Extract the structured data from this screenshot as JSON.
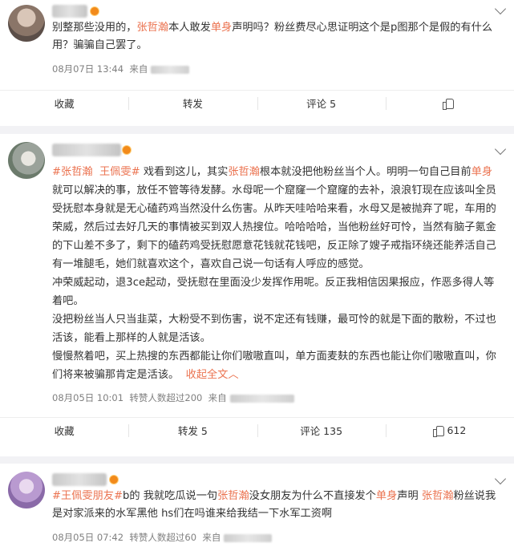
{
  "posts": [
    {
      "content": {
        "s1": "别整那些没用的，",
        "name1": "张哲瀚",
        "s2": "本人敢发",
        "kw1": "单身",
        "s3": "声明吗？粉丝费尽心思证明这个是p图那个是假的有什么用？骗骗自己罢了。"
      },
      "time": "08月07日 13:44",
      "source_prefix": "来自",
      "actions": {
        "fav": "收藏",
        "repost": "转发",
        "comment": "评论 5",
        "like": ""
      }
    },
    {
      "content": {
        "tag1": "#张哲瀚",
        "tag2": "王佩雯#",
        "a1": " 戏看到这儿，其实",
        "name1": "张哲瀚",
        "a2": "根本就没把他粉丝当个人。明明一句自己目前",
        "kw1": "单身",
        "a3": "就可以解决的事，放任不管等待发酵。水母呢一个窟窿一个窟窿的去补，浪浪钉现在应该叫全员受抚慰本身就是无心磕药鸡当然没什么伤害。从昨天哇哈哈来看，水母又是被抛弃了呢，车用的荣威，然后过去好几天的事情被买到双人热搜位。哈哈哈哈，当他粉丝好可怜，当然有脑子氪金的下山差不多了，剩下的磕药鸡受抚慰愿意花钱就花钱吧，反正除了嫂子戒指环绕还能养活自己有一堆腿毛，她们就喜欢这个，喜欢自己说一句话有人呼应的感觉。",
        "p2": "冲荣威起动，退3ce起动，受抚慰在里面没少发挥作用呢。反正我相信因果报应，作恶多得人等着吧。",
        "p3": "没把粉丝当人只当韭菜，大粉受不到伤害，说不定还有钱赚，最可怜的就是下面的散粉，不过也活该，能看上那样的人就是活该。",
        "p4": "慢慢熬着吧，买上热搜的东西都能让你们嗷嗷直叫，单方面麦麸的东西也能让你们嗷嗷直叫，你们将来被骗那肯定是活该。",
        "collapse": "收起全文",
        "collapse_icon": "chevron-up-icon"
      },
      "time": "08月05日 10:01",
      "meta_extra": "转赞人数超过200",
      "source_prefix": "来自",
      "actions": {
        "fav": "收藏",
        "repost": "转发 5",
        "comment": "评论 135",
        "like": "612"
      }
    },
    {
      "content": {
        "tag1": "#王佩雯朋友#",
        "b1": "b的 我就吃瓜说一句",
        "name1": "张哲瀚",
        "b2": "没女朋友为什么不直接发个",
        "kw1": "单身",
        "b3": "声明 ",
        "name2": "张哲瀚",
        "b4": "粉丝说我是对家派来的水军黑他 hs们在吗谁来给我结一下水军工资啊"
      },
      "time": "08月05日 07:42",
      "meta_extra": "转赞人数超过60",
      "source_prefix": "来自"
    }
  ],
  "colors": {
    "accent": "#eb7350",
    "meta": "#808080",
    "text": "#333333"
  }
}
